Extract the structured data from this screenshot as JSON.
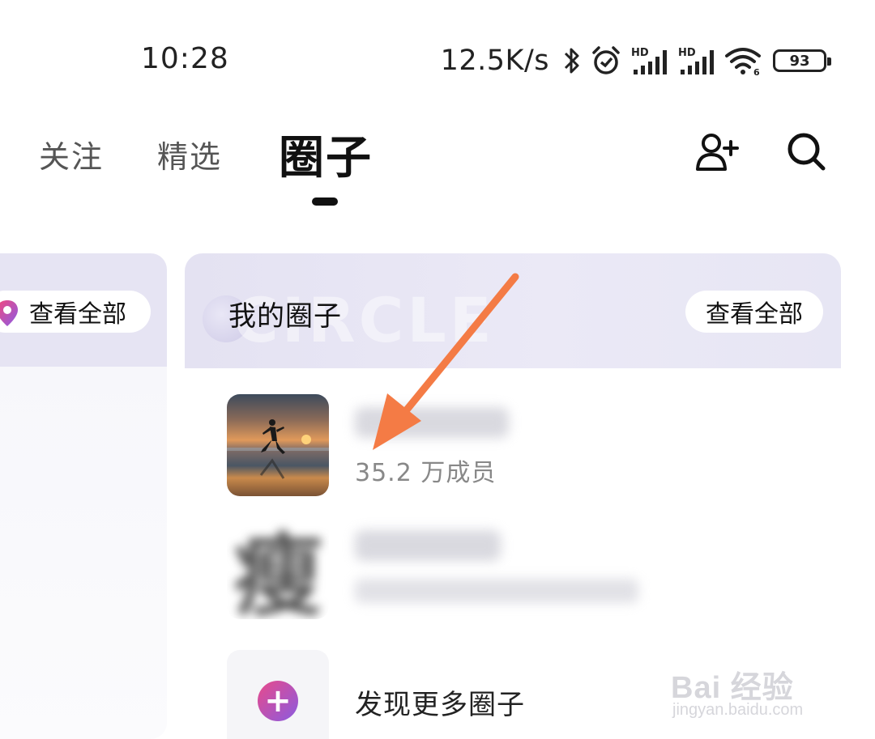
{
  "status_bar": {
    "time": "10:28",
    "network_speed": "12.5K/s",
    "battery_level": "93",
    "icons": [
      "bluetooth-icon",
      "alarm-icon",
      "hd-signal-icon",
      "hd-signal-icon",
      "wifi-icon",
      "battery-icon"
    ],
    "signal_label": "HD"
  },
  "tabs": {
    "items": [
      {
        "label": "关注"
      },
      {
        "label": "精选"
      },
      {
        "label": "圈子"
      }
    ],
    "active_index": 2
  },
  "header_actions": {
    "icons": [
      "add-friend-icon",
      "search-icon"
    ]
  },
  "left_card": {
    "view_all_label": "查看全部",
    "icon": "location-pin-icon"
  },
  "my_circles": {
    "title": "我的圈子",
    "watermark": "CIRCLE",
    "view_all_label": "查看全部",
    "items": [
      {
        "members": "35.2 万成员"
      },
      {
        "thumb_glyph": "瘦"
      }
    ],
    "discover_label": "发现更多圈子"
  },
  "watermark": {
    "brand": "Bai 经验",
    "site": "jingyan.baidu.com"
  },
  "colors": {
    "accent_arrow": "#f47b45",
    "card_header": "#e6e4f3",
    "plus_gradient_start": "#e94a8a",
    "plus_gradient_end": "#8a5be0"
  }
}
